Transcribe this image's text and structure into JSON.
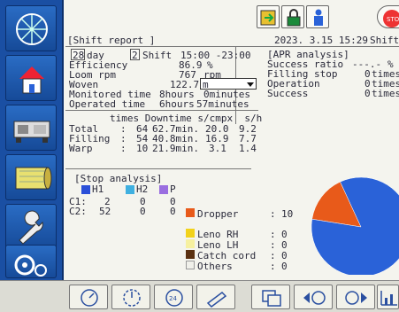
{
  "header": {
    "title": "[Shift report ]",
    "date": "2023. 3.15 15:29",
    "shift_label": "Shift"
  },
  "period": {
    "day_value": "28",
    "day_label": "day",
    "shift_value": "2",
    "shift_label": "Shift",
    "time_range": "15:00 -23:00"
  },
  "metrics": [
    {
      "label": "Efficiency",
      "value": "86.9",
      "unit": "%"
    },
    {
      "label": "Loom rpm",
      "value": "767",
      "unit": "rpm"
    },
    {
      "label": "Woven",
      "value": "122.7",
      "unit": "m"
    },
    {
      "label": "Monitored time",
      "value": "8hours",
      "unit": "0minutes"
    },
    {
      "label": "Operated time",
      "value": "6hours",
      "unit": "57minutes"
    }
  ],
  "woven_unit_option": "m",
  "stops_table": {
    "header": "times Downtime s/cmpx  s/h",
    "rows": [
      {
        "label": "Total",
        "times": "64",
        "downtime": "62.7min.",
        "s_cmpx": "20.0",
        "s_h": "9.2"
      },
      {
        "label": "Filling",
        "times": "54",
        "downtime": "40.8min.",
        "s_cmpx": "16.9",
        "s_h": "7.7"
      },
      {
        "label": "Warp",
        "times": "10",
        "downtime": "21.9min.",
        "s_cmpx": "3.1",
        "s_h": "1.4"
      }
    ]
  },
  "apr": {
    "title": "[APR analysis]",
    "rows": [
      {
        "label": "Success ratio",
        "value": "---.-",
        "unit": "%"
      },
      {
        "label": "Filling stop",
        "value": "0",
        "unit": "times"
      },
      {
        "label": "Operation",
        "value": "0",
        "unit": "times"
      },
      {
        "label": "Success",
        "value": "0",
        "unit": "times"
      }
    ]
  },
  "stop_analysis": {
    "title": "[Stop analysis]",
    "legend": [
      {
        "label": "H1",
        "color": "#2a4fd8"
      },
      {
        "label": "H2",
        "color": "#3fb0e0"
      },
      {
        "label": "P",
        "color": "#9a6ee0"
      }
    ],
    "rows": [
      {
        "label": "C1:",
        "h1": "2",
        "h2": "0",
        "p": "0"
      },
      {
        "label": "C2:",
        "h1": "52",
        "h2": "0",
        "p": "0"
      }
    ],
    "causes": [
      {
        "label": "Dropper",
        "color": "#e85a1a",
        "sep": ":",
        "value": "10"
      },
      {
        "label": "Leno RH",
        "color": "#f2d21a",
        "sep": ":",
        "value": "0"
      },
      {
        "label": "Leno LH",
        "color": "#f6f0a0",
        "sep": ":",
        "value": "0"
      },
      {
        "label": "Catch cord",
        "color": "#5a3010",
        "sep": ":",
        "value": "0"
      },
      {
        "label": "Others",
        "color": "#f0f0ea",
        "sep": ":",
        "value": "0"
      }
    ]
  },
  "chart_data": {
    "type": "pie",
    "slices": [
      {
        "name": "Filling",
        "value": 54,
        "color": "#2a62d8"
      },
      {
        "name": "Dropper",
        "value": 10,
        "color": "#e85a1a"
      }
    ]
  },
  "icons": {
    "sidebar": [
      "loom-icon",
      "home-icon",
      "machine-icon",
      "fabric-roll-icon",
      "wrench-icon",
      "settings-gear-icon"
    ],
    "top": [
      "login-icon",
      "lock-icon",
      "operator-icon",
      "stop-icon"
    ],
    "bottom": [
      "speed-icon",
      "rpm-icon",
      "24h-icon",
      "pencil-icon",
      "copy-icon",
      "prev-icon",
      "next-icon",
      "graph-icon"
    ]
  }
}
